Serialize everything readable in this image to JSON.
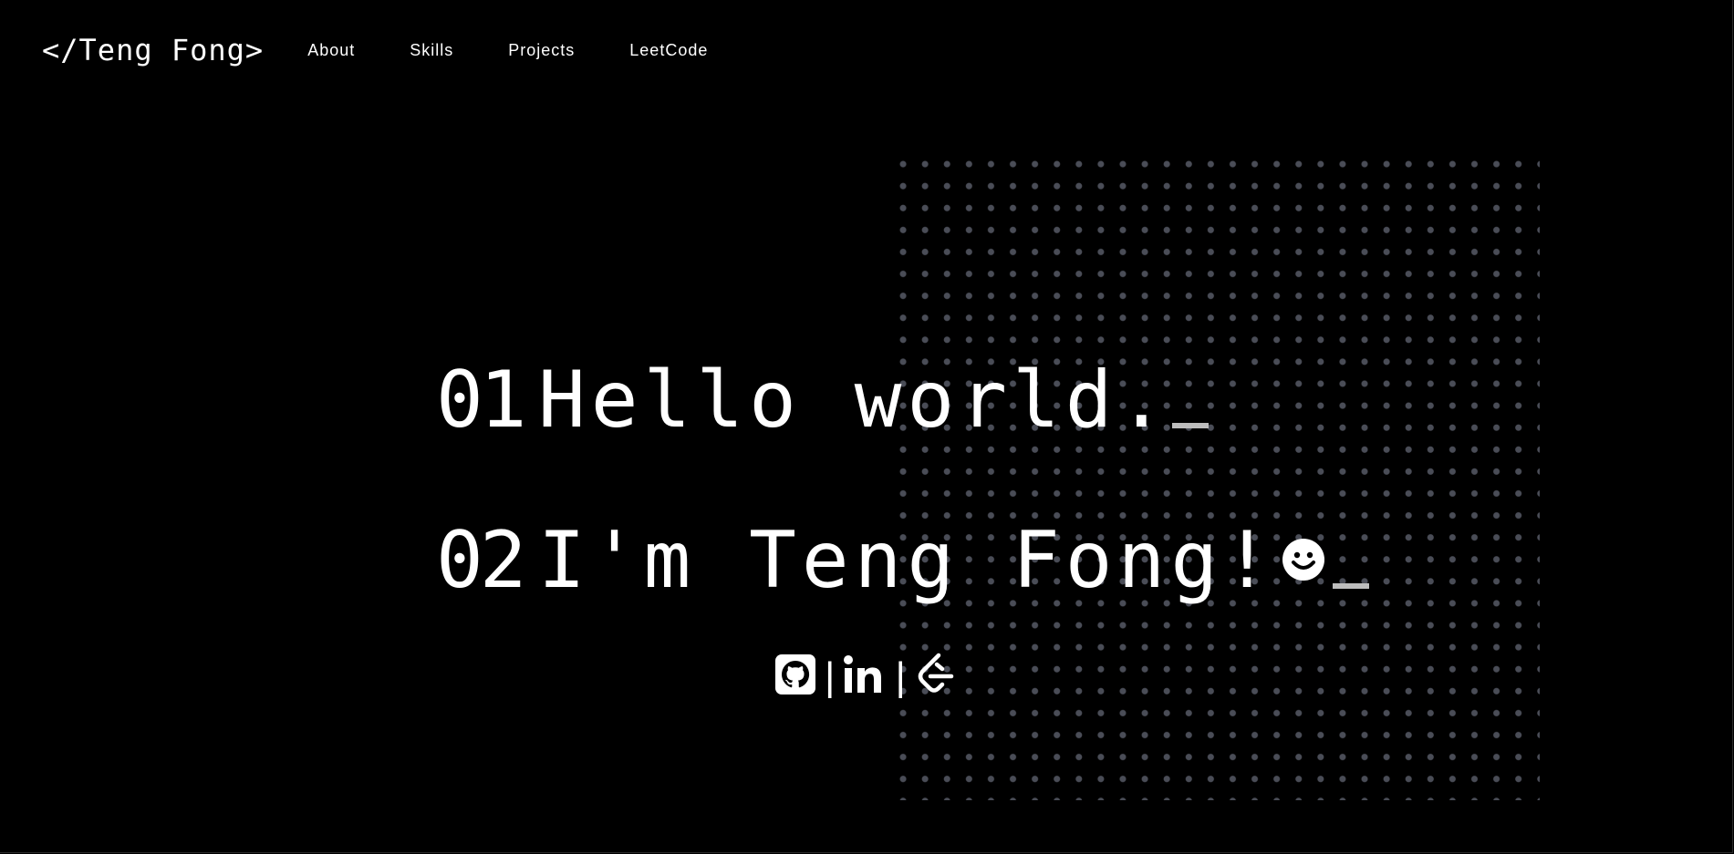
{
  "header": {
    "logo": "</Teng Fong>",
    "nav": [
      {
        "label": "About"
      },
      {
        "label": "Skills"
      },
      {
        "label": "Projects"
      },
      {
        "label": "LeetCode"
      }
    ]
  },
  "hero": {
    "lines": [
      {
        "number": "01",
        "text": "Hello world."
      },
      {
        "number": "02",
        "text": "I'm Teng Fong! "
      }
    ],
    "cursor": "_",
    "smiley_icon": "smiley-face-icon"
  },
  "social": {
    "links": [
      {
        "icon": "github-icon"
      },
      {
        "icon": "linkedin-icon"
      },
      {
        "icon": "leetcode-icon"
      }
    ],
    "separator": "|"
  },
  "colors": {
    "background": "#000000",
    "text": "#ffffff",
    "cursor": "#bdbdbd",
    "grid_dot": "#4a4d57"
  }
}
